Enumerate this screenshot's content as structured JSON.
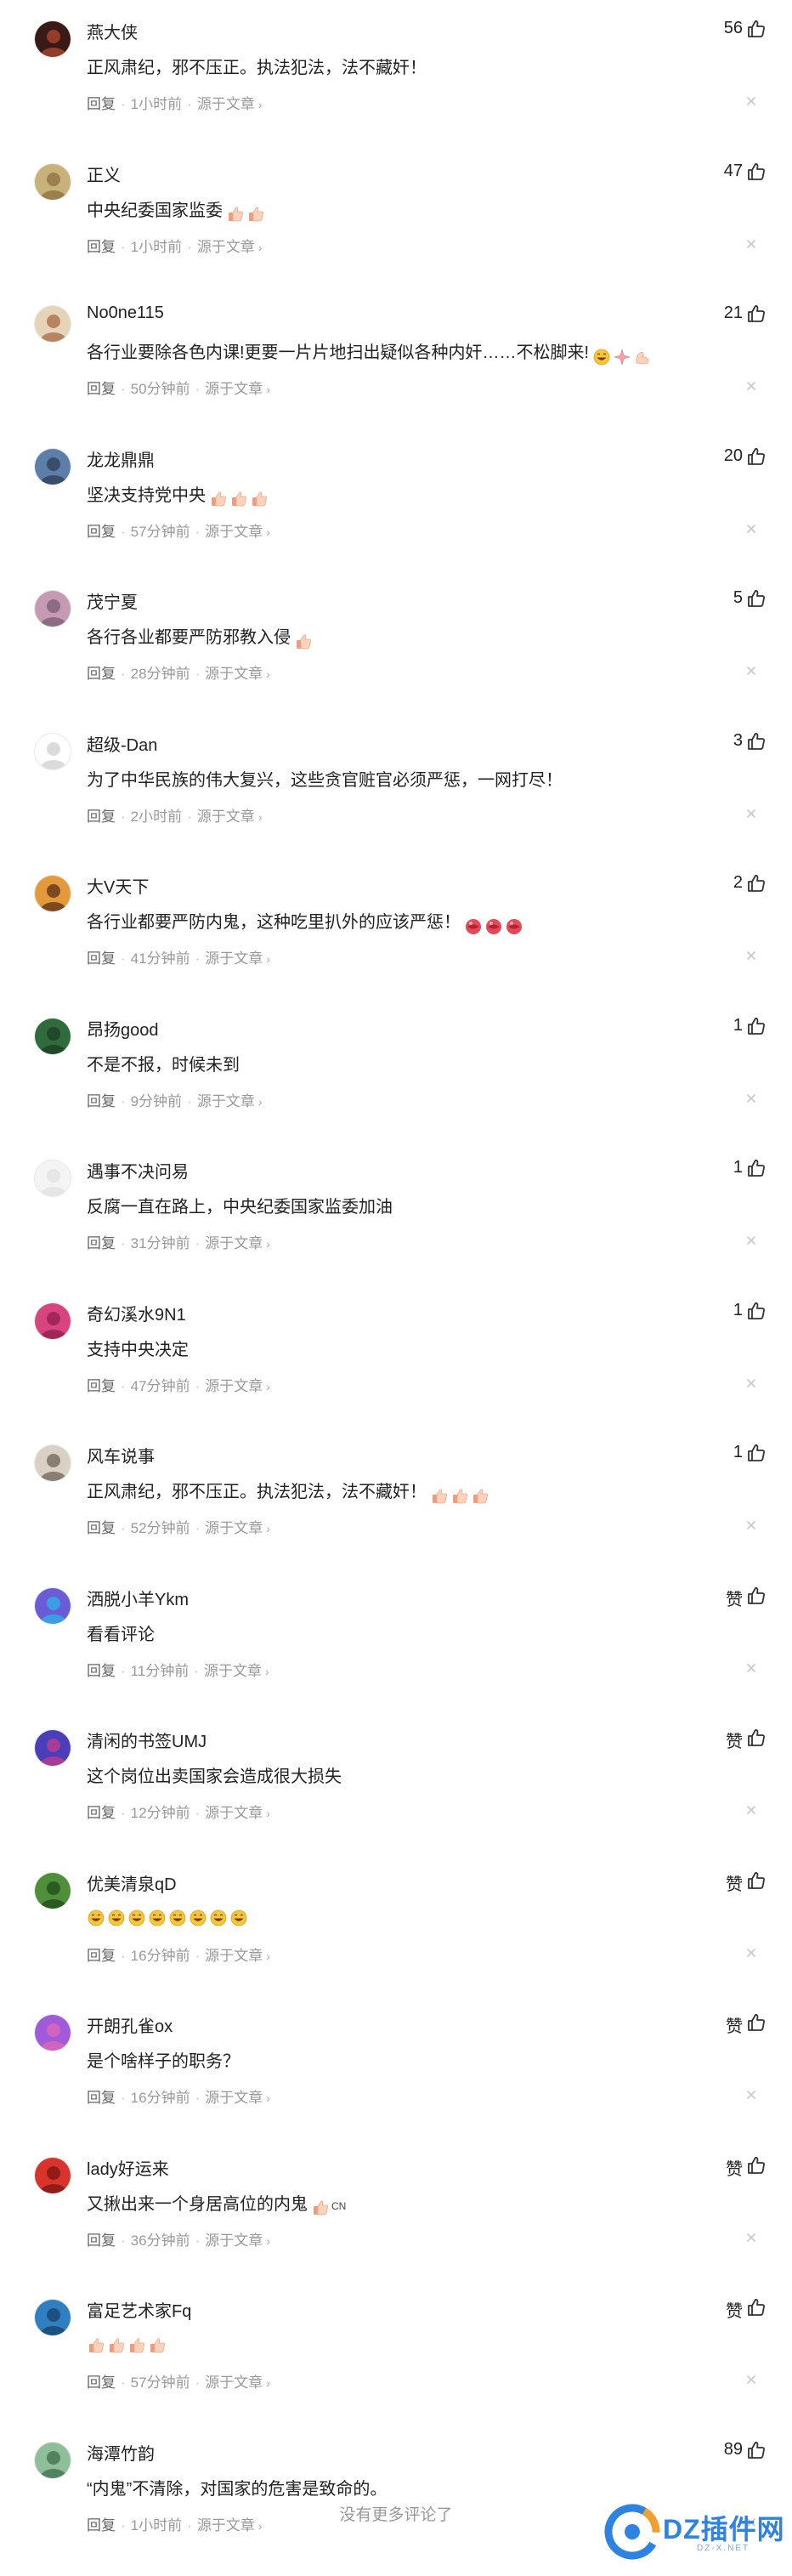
{
  "ui": {
    "reply_label": "回复",
    "source_label": "源于文章",
    "footer_text": "没有更多评论了",
    "watermark_text": "DZ插件网",
    "watermark_sub": "DZ-X.NET"
  },
  "comments": [
    {
      "username": "燕大侠",
      "likes": "56",
      "content": "正风肃纪，邪不压正。执法犯法，法不藏奸！",
      "time": "1小时前",
      "avatar_colors": [
        "#3a1a16",
        "#b04a2f"
      ],
      "emojis": []
    },
    {
      "username": "正义",
      "likes": "47",
      "content": "中央纪委国家监委",
      "time": "1小时前",
      "avatar_colors": [
        "#c8b27a",
        "#8a6f3e"
      ],
      "emojis": [
        "thumbs-up-emoji",
        "thumbs-up-emoji"
      ]
    },
    {
      "username": "No0ne115",
      "likes": "21",
      "content": "各行业要除各色内课!更要一片片地扫出疑似各种内奸……不松脚来!",
      "time": "50分钟前",
      "avatar_colors": [
        "#e6d4b8",
        "#a56a44"
      ],
      "emojis": [
        "grin-emoji",
        "sparkle-emoji",
        "muscle-emoji"
      ]
    },
    {
      "username": "龙龙鼎鼎",
      "likes": "20",
      "content": "坚决支持党中央",
      "time": "57分钟前",
      "avatar_colors": [
        "#5c7ea8",
        "#2c3e57"
      ],
      "emojis": [
        "thumbs-up-emoji",
        "thumbs-up-emoji",
        "thumbs-up-emoji"
      ]
    },
    {
      "username": "茂宁夏",
      "likes": "5",
      "content": "各行各业都要严防邪教入侵",
      "time": "28分钟前",
      "avatar_colors": [
        "#c59ab3",
        "#7b5a73"
      ],
      "emojis": [
        "thumbs-up-emoji"
      ]
    },
    {
      "username": "超级-Dan",
      "likes": "3",
      "content": "为了中华民族的伟大复兴，这些贪官赃官必须严惩，一网打尽！",
      "time": "2小时前",
      "avatar_colors": [
        "#ffffff",
        "#cfcfcf"
      ],
      "emojis": []
    },
    {
      "username": "大V天下",
      "likes": "2",
      "content": "各行业都要严防内鬼，这种吃里扒外的应该严惩！",
      "time": "41分钟前",
      "avatar_colors": [
        "#e49a3a",
        "#5a2d1a"
      ],
      "emojis": [
        "lips-emoji",
        "lips-emoji",
        "lips-emoji"
      ]
    },
    {
      "username": "昂扬good",
      "likes": "1",
      "content": "不是不报，时候未到",
      "time": "9分钟前",
      "avatar_colors": [
        "#2f6b3c",
        "#1b3d22"
      ],
      "emojis": []
    },
    {
      "username": "遇事不决问易",
      "likes": "1",
      "content": "反腐一直在路上，中央纪委国家监委加油",
      "time": "31分钟前",
      "avatar_colors": [
        "#f4f4f4",
        "#e2e2e2"
      ],
      "emojis": []
    },
    {
      "username": "奇幻溪水9N1",
      "likes": "1",
      "content": "支持中央决定",
      "time": "47分钟前",
      "avatar_colors": [
        "#d8457e",
        "#8e1d4c"
      ],
      "emojis": []
    },
    {
      "username": "风车说事",
      "likes": "1",
      "content": "正风肃纪，邪不压正。执法犯法，法不藏奸！",
      "time": "52分钟前",
      "avatar_colors": [
        "#d9d2c4",
        "#6d6255"
      ],
      "emojis": [
        "thumbs-up-emoji",
        "thumbs-up-emoji",
        "thumbs-up-emoji"
      ]
    },
    {
      "username": "洒脱小羊Ykm",
      "likes": "赞",
      "content": "看看评论",
      "time": "11分钟前",
      "avatar_colors": [
        "#6b5bd6",
        "#2bb3e8"
      ],
      "emojis": []
    },
    {
      "username": "清闲的书签UMJ",
      "likes": "赞",
      "content": "这个岗位出卖国家会造成很大损失",
      "time": "12分钟前",
      "avatar_colors": [
        "#4a3fb8",
        "#c43c8e"
      ],
      "emojis": []
    },
    {
      "username": "优美清泉qD",
      "likes": "赞",
      "content": "",
      "time": "16分钟前",
      "avatar_colors": [
        "#4f8f3a",
        "#1e4a1a"
      ],
      "emojis": [
        "laugh-emoji",
        "laugh-emoji",
        "laugh-emoji",
        "laugh-emoji",
        "laugh-emoji",
        "laugh-emoji",
        "laugh-emoji",
        "laugh-emoji"
      ]
    },
    {
      "username": "开朗孔雀ox",
      "likes": "赞",
      "content": "是个啥样子的职务？",
      "time": "16分钟前",
      "avatar_colors": [
        "#a15ad8",
        "#e069b8"
      ],
      "emojis": []
    },
    {
      "username": "lady好运来",
      "likes": "赞",
      "content": "又揪出来一个身居高位的内鬼",
      "time": "36分钟前",
      "avatar_colors": [
        "#d8342c",
        "#7a1410"
      ],
      "emojis": [
        "thumbs-up-emoji"
      ],
      "suffix": "CN"
    },
    {
      "username": "富足艺术家Fq",
      "likes": "赞",
      "content": "",
      "time": "57分钟前",
      "avatar_colors": [
        "#2f7fc1",
        "#17406b"
      ],
      "emojis": [
        "thumbs-up-emoji",
        "thumbs-up-emoji",
        "thumbs-up-emoji",
        "thumbs-up-emoji"
      ]
    },
    {
      "username": "海潭竹韵",
      "likes": "89",
      "content": "“内鬼”不清除，对国家的危害是致命的。",
      "time": "1小时前",
      "avatar_colors": [
        "#8fbf9a",
        "#3d6e4c"
      ],
      "emojis": []
    }
  ]
}
